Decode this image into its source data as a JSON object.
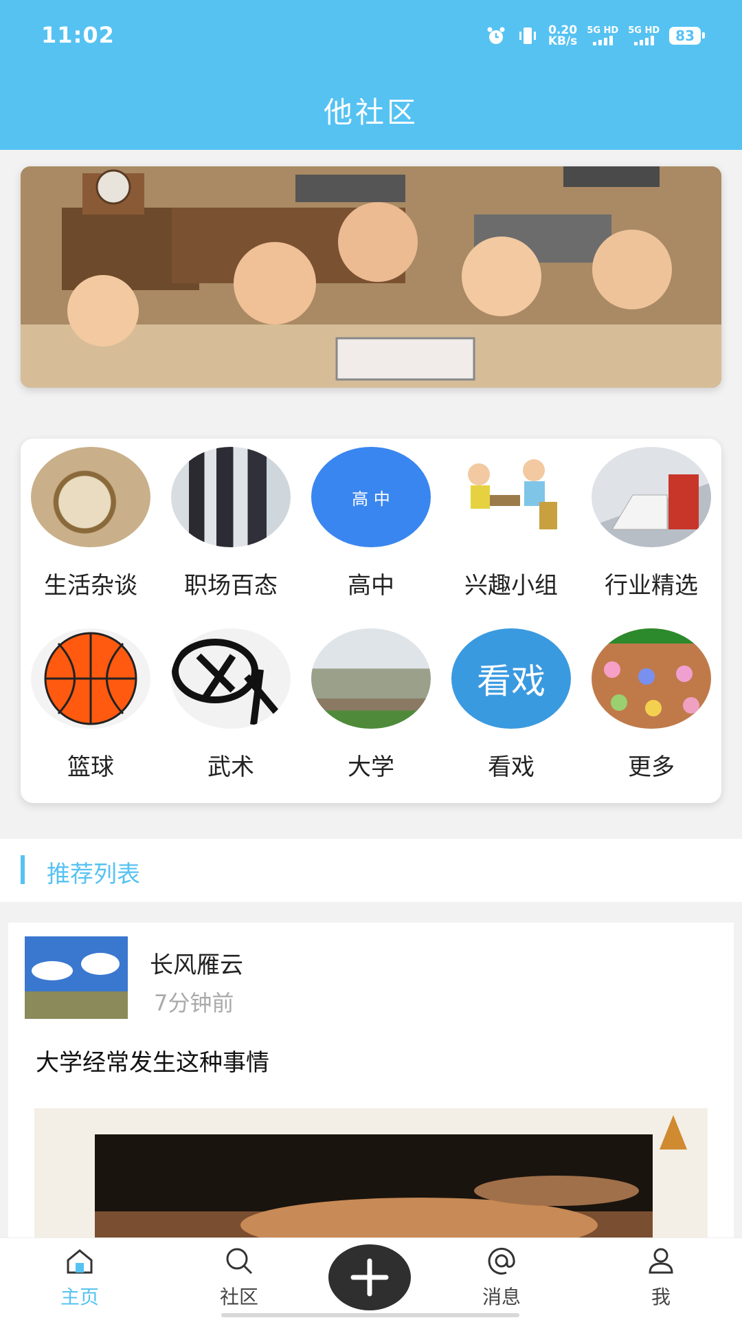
{
  "status_bar": {
    "time": "11:02",
    "net_speed_value": "0.20",
    "net_speed_unit": "KB/s",
    "signal1_label": "5G HD",
    "signal2_label": "5G HD",
    "battery": "83",
    "icons": [
      "alarm-icon",
      "vibrate-icon"
    ]
  },
  "header": {
    "title": "他社区"
  },
  "categories": [
    {
      "label": "生活杂谈",
      "icon": "pocket-watch-image"
    },
    {
      "label": "职场百态",
      "icon": "office-people-image"
    },
    {
      "label": "高中",
      "icon": "high-school-badge",
      "badge_text": "高 中"
    },
    {
      "label": "兴趣小组",
      "icon": "chess-kids-image"
    },
    {
      "label": "行业精选",
      "icon": "stairs-tax-image"
    },
    {
      "label": "篮球",
      "icon": "basketball-image"
    },
    {
      "label": "武术",
      "icon": "calligraphy-image"
    },
    {
      "label": "大学",
      "icon": "university-gate-image"
    },
    {
      "label": "看戏",
      "icon": "watch-show-badge",
      "badge_text": "看戏"
    },
    {
      "label": "更多",
      "icon": "snails-image"
    }
  ],
  "recommend": {
    "title": "推荐列表"
  },
  "post": {
    "author": "长风雁云",
    "time": "7分钟前",
    "text": "大学经常发生这种事情"
  },
  "bottom_nav": {
    "items": [
      {
        "label": "主页",
        "icon": "home-icon",
        "active": true
      },
      {
        "label": "社区",
        "icon": "search-icon",
        "active": false
      },
      {
        "label": "消息",
        "icon": "at-icon",
        "active": false
      },
      {
        "label": "我",
        "icon": "person-icon",
        "active": false
      }
    ],
    "fab_icon": "plus-icon"
  },
  "colors": {
    "accent": "#56c2f2",
    "fab": "#2f2f2f",
    "muted_text": "#aaaaaa"
  }
}
